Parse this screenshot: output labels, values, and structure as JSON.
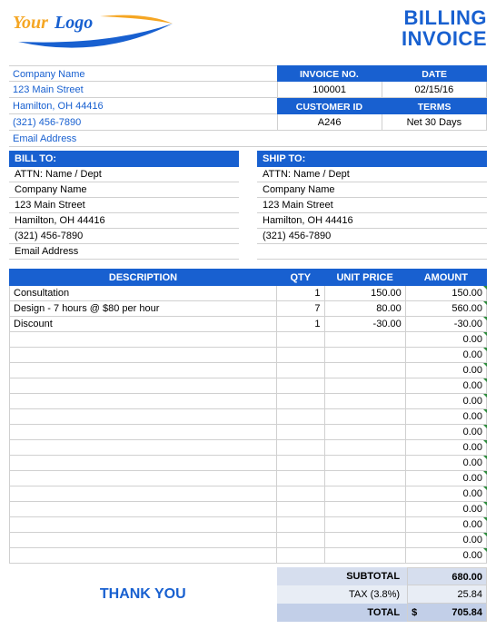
{
  "logo": {
    "text1": "Your",
    "text2": "Logo"
  },
  "title": {
    "line1": "BILLING",
    "line2": "INVOICE"
  },
  "company": {
    "name": "Company Name",
    "street": "123 Main Street",
    "citystate": "Hamilton, OH  44416",
    "phone": "(321) 456-7890",
    "email": "Email Address"
  },
  "meta": {
    "hdr_invoice": "INVOICE NO.",
    "hdr_date": "DATE",
    "invoice_no": "100001",
    "date": "02/15/16",
    "hdr_customer": "CUSTOMER ID",
    "hdr_terms": "TERMS",
    "customer_id": "A246",
    "terms": "Net 30 Days"
  },
  "billto": {
    "hdr": "BILL TO:",
    "attn": "ATTN: Name / Dept",
    "company": "Company Name",
    "street": "123 Main Street",
    "citystate": "Hamilton, OH  44416",
    "phone": "(321) 456-7890",
    "email": "Email Address"
  },
  "shipto": {
    "hdr": "SHIP TO:",
    "attn": "ATTN: Name / Dept",
    "company": "Company Name",
    "street": "123 Main Street",
    "citystate": "Hamilton, OH  44416",
    "phone": "(321) 456-7890",
    "email": ""
  },
  "items_hdr": {
    "desc": "DESCRIPTION",
    "qty": "QTY",
    "price": "UNIT PRICE",
    "amt": "AMOUNT"
  },
  "items": [
    {
      "desc": "Consultation",
      "qty": "1",
      "price": "150.00",
      "amt": "150.00"
    },
    {
      "desc": "Design - 7 hours @ $80 per hour",
      "qty": "7",
      "price": "80.00",
      "amt": "560.00"
    },
    {
      "desc": "Discount",
      "qty": "1",
      "price": "-30.00",
      "amt": "-30.00"
    },
    {
      "desc": "",
      "qty": "",
      "price": "",
      "amt": "0.00"
    },
    {
      "desc": "",
      "qty": "",
      "price": "",
      "amt": "0.00"
    },
    {
      "desc": "",
      "qty": "",
      "price": "",
      "amt": "0.00"
    },
    {
      "desc": "",
      "qty": "",
      "price": "",
      "amt": "0.00"
    },
    {
      "desc": "",
      "qty": "",
      "price": "",
      "amt": "0.00"
    },
    {
      "desc": "",
      "qty": "",
      "price": "",
      "amt": "0.00"
    },
    {
      "desc": "",
      "qty": "",
      "price": "",
      "amt": "0.00"
    },
    {
      "desc": "",
      "qty": "",
      "price": "",
      "amt": "0.00"
    },
    {
      "desc": "",
      "qty": "",
      "price": "",
      "amt": "0.00"
    },
    {
      "desc": "",
      "qty": "",
      "price": "",
      "amt": "0.00"
    },
    {
      "desc": "",
      "qty": "",
      "price": "",
      "amt": "0.00"
    },
    {
      "desc": "",
      "qty": "",
      "price": "",
      "amt": "0.00"
    },
    {
      "desc": "",
      "qty": "",
      "price": "",
      "amt": "0.00"
    },
    {
      "desc": "",
      "qty": "",
      "price": "",
      "amt": "0.00"
    },
    {
      "desc": "",
      "qty": "",
      "price": "",
      "amt": "0.00"
    }
  ],
  "totals": {
    "subtotal_lbl": "SUBTOTAL",
    "subtotal": "680.00",
    "tax_lbl": "TAX (3.8%)",
    "tax": "25.84",
    "total_lbl": "TOTAL",
    "total_cur": "$",
    "total": "705.84"
  },
  "thanks": "THANK YOU"
}
